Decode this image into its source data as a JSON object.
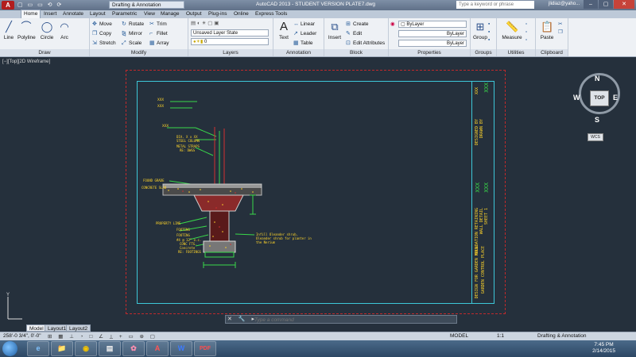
{
  "titlebar": {
    "app_logo": "A",
    "quick_access": "▢ ▭ ▭ ⟲ ⟳",
    "workspace": "Drafting & Annotation",
    "title": "AutoCAD 2013 - STUDENT VERSION    PLATE7.dwg",
    "search_placeholder": "Type a keyword or phrase",
    "user": "jlidiaz@yaho...",
    "minimize": "–",
    "maximize": "▢",
    "close": "✕"
  },
  "tabs": [
    "Home",
    "Insert",
    "Annotate",
    "Layout",
    "Parametric",
    "View",
    "Manage",
    "Output",
    "Plug-ins",
    "Online",
    "Express Tools"
  ],
  "ribbon": {
    "draw": {
      "label": "Draw",
      "line": "Line",
      "polyline": "Polyline",
      "circle": "Circle",
      "arc": "Arc"
    },
    "modify": {
      "label": "Modify",
      "move": "Move",
      "rotate": "Rotate",
      "trim": "Trim",
      "copy": "Copy",
      "mirror": "Mirror",
      "fillet": "Fillet",
      "stretch": "Stretch",
      "scale": "Scale",
      "array": "Array"
    },
    "layers": {
      "label": "Layers",
      "layer_state": "Unsaved Layer State",
      "current_layer": "0"
    },
    "annotation": {
      "label": "Annotation",
      "text": "Text",
      "linear": "Linear",
      "leader": "Leader",
      "table": "Table"
    },
    "block": {
      "label": "Block",
      "insert": "Insert",
      "create": "Create",
      "edit": "Edit",
      "edit_attributes": "Edit Attributes"
    },
    "properties": {
      "label": "Properties",
      "color": "ByLayer",
      "linetype": "ByLayer",
      "lineweight": "ByLayer"
    },
    "groups": {
      "label": "Groups",
      "group": "Group"
    },
    "utilities": {
      "label": "Utilities",
      "measure": "Measure"
    },
    "clipboard": {
      "label": "Clipboard",
      "paste": "Paste"
    }
  },
  "viewport": {
    "label": "[−][Top][2D Wireframe]"
  },
  "viewcube": {
    "n": "N",
    "s": "S",
    "e": "E",
    "w": "W",
    "face": "TOP",
    "wcs": "WCS"
  },
  "drawing": {
    "callouts": [
      "XXX",
      "XXX",
      "XXX",
      "DIA. X x XX",
      "STEEL COLUMN",
      "METAL STRAPS",
      "RE: DWGS",
      "FOUND GRADE",
      "CONCRETE SLAB",
      "PROPERTY LINE",
      "FOOTING",
      "FOOTING",
      "#4 @ 12\" o.c.",
      "CONC FTG.",
      "Concrete",
      "RE: FOOTINGS"
    ],
    "note": "Infill Oleander shrub, Oleander shrub for planter in the Nerium",
    "titleblock": [
      "XXX",
      "XXX",
      "DESIGNED BY",
      "DRAWN BY",
      "XXX",
      "XXX",
      "FOUNDATION RETAINING",
      "WALL DETAIL",
      "SHEET 1",
      "DESIGN FOR GARDEN WALL",
      "GARDEN CONTROL PLACE"
    ]
  },
  "command": {
    "buttons": "✕ 🔧 ▸",
    "placeholder": "Type a command"
  },
  "layout_tabs": [
    "Model",
    "Layout1",
    "Layout2"
  ],
  "status": {
    "coords": "258'-0 3/4\", 0'-0\"",
    "model": "MODEL",
    "scale": "1:1",
    "workspace": "Drafting & Annotation"
  },
  "taskbar": {
    "apps": [
      "e",
      "📁",
      "◉",
      "▤",
      "✿",
      "A",
      "W",
      "PDF"
    ],
    "time": "7:45 PM",
    "date": "2/14/2015"
  },
  "colors": {
    "accent": "#3dc7d8",
    "border_red": "#c0292b",
    "text_yellow": "#ffd52a",
    "green": "#39d84a"
  }
}
